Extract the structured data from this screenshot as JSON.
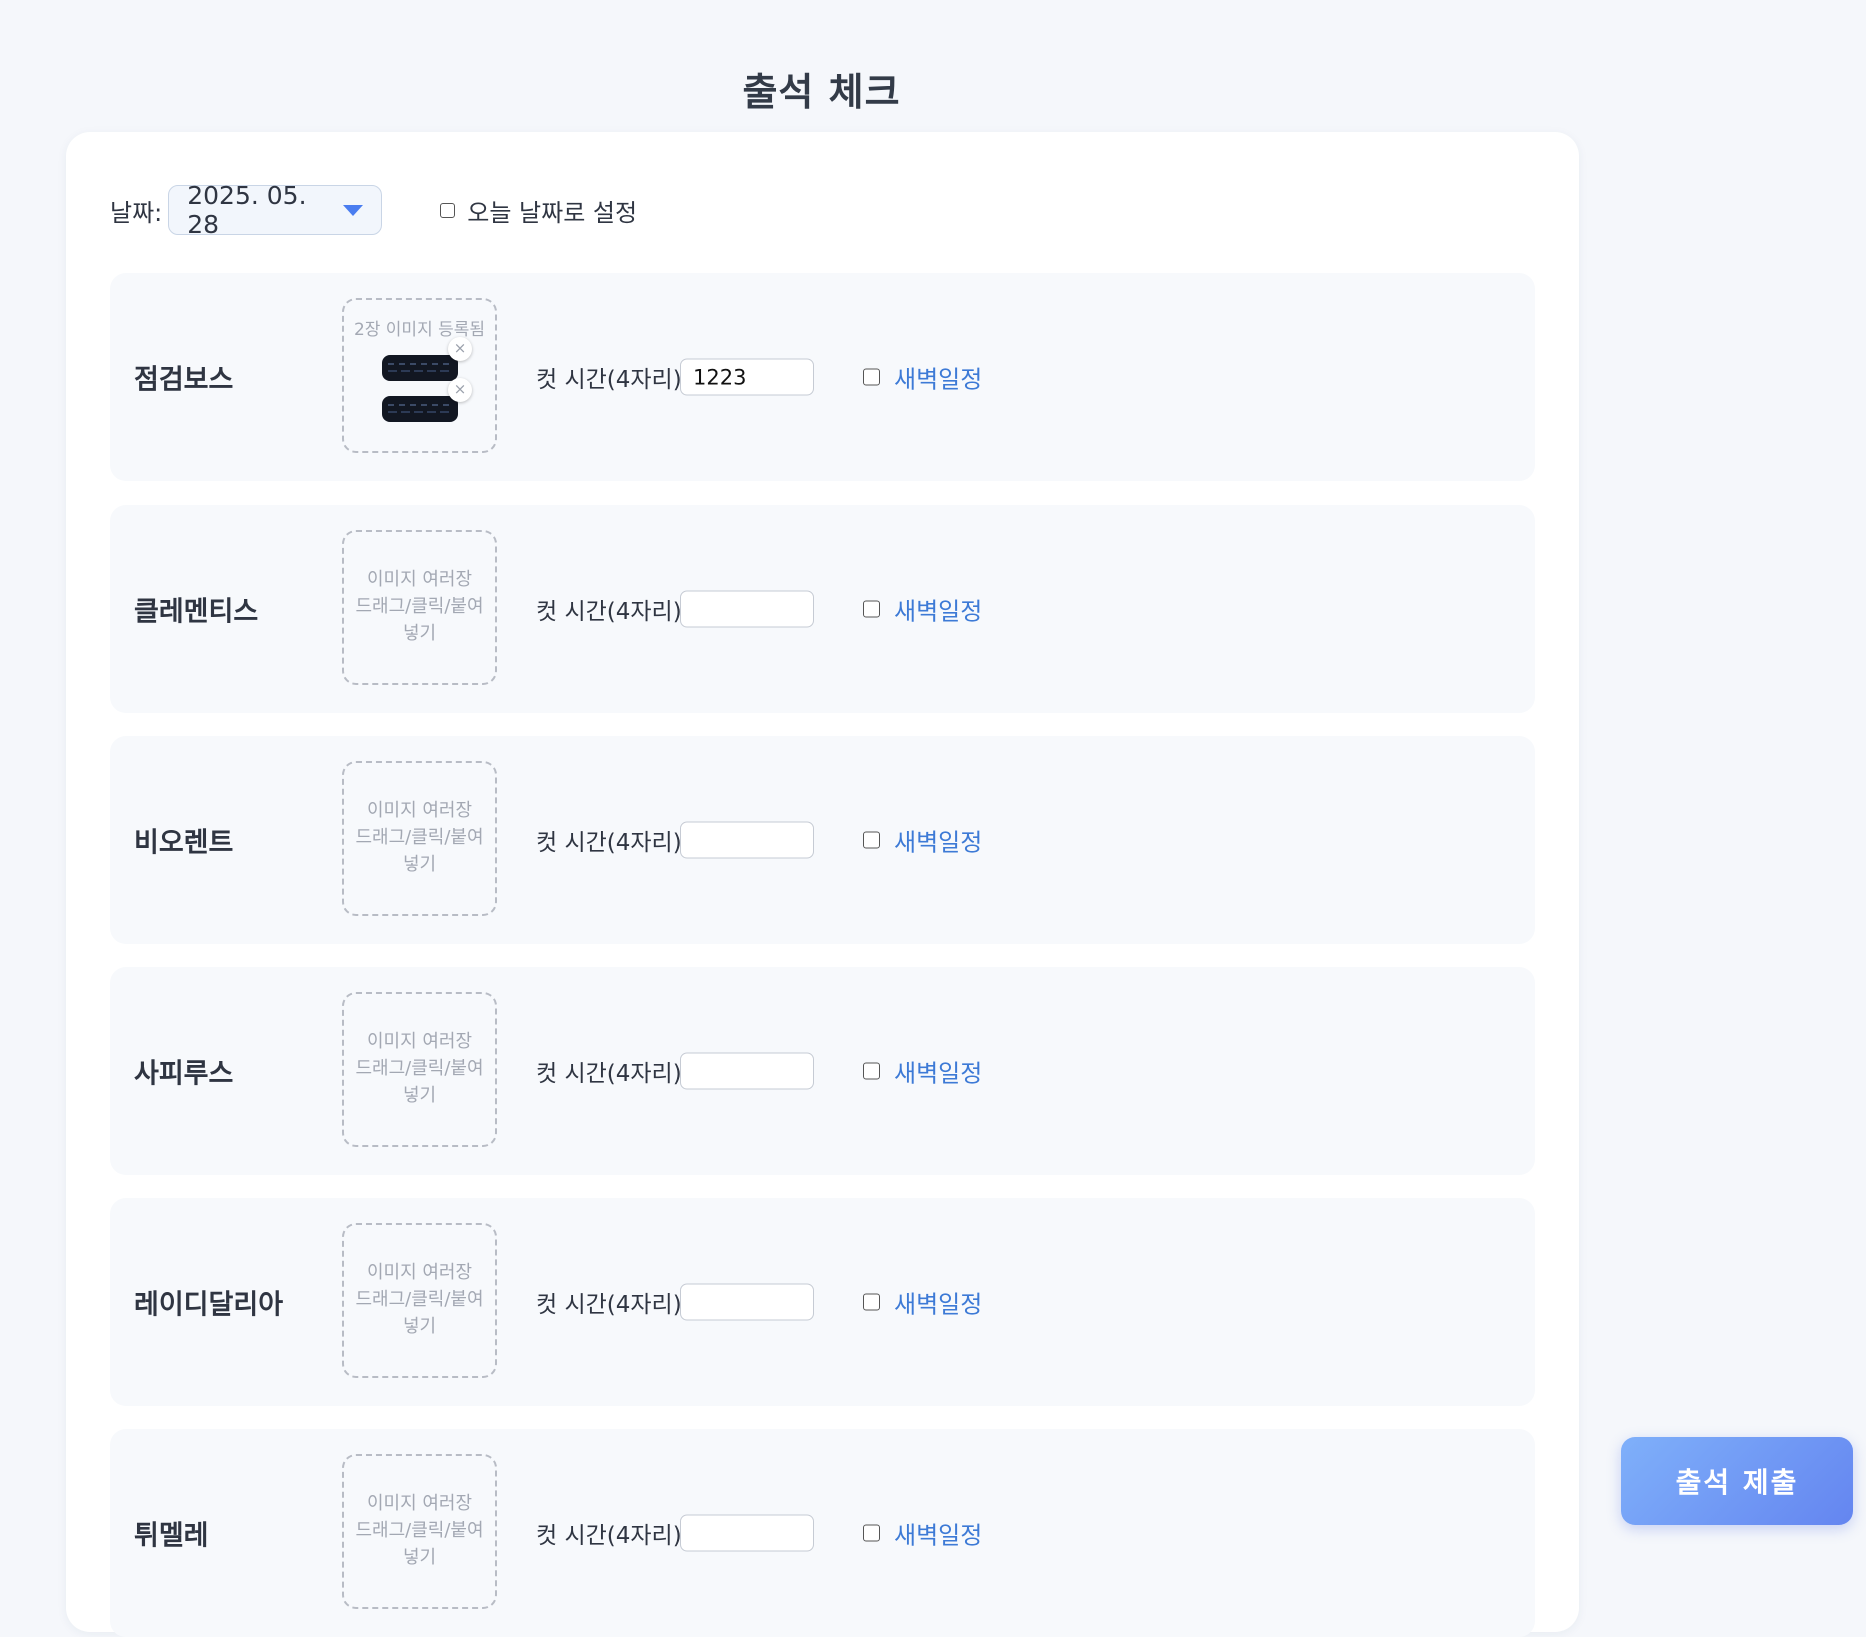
{
  "page": {
    "title": "출석 체크"
  },
  "date_row": {
    "label": "날짜:",
    "selected_date": "2025. 05. 28",
    "today_toggle_label": "오늘 날짜로 설정"
  },
  "bosses": [
    {
      "name": "점검보스",
      "dropzone_count_text": "2장 이미지 등록됨",
      "images": [
        "image-1",
        "image-2"
      ],
      "cut_label": "컷 시간(4자리)",
      "cut_value": "1223",
      "dawn_label": "새벽일정"
    },
    {
      "name": "클레멘티스",
      "dropzone_hint": "이미지 여러장\n드래그/클릭/붙여\n넣기",
      "cut_label": "컷 시간(4자리)",
      "cut_value": "",
      "dawn_label": "새벽일정"
    },
    {
      "name": "비오렌트",
      "dropzone_hint": "이미지 여러장\n드래그/클릭/붙여\n넣기",
      "cut_label": "컷 시간(4자리)",
      "cut_value": "",
      "dawn_label": "새벽일정"
    },
    {
      "name": "사피루스",
      "dropzone_hint": "이미지 여러장\n드래그/클릭/붙여\n넣기",
      "cut_label": "컷 시간(4자리)",
      "cut_value": "",
      "dawn_label": "새벽일정"
    },
    {
      "name": "레이디달리아",
      "dropzone_hint": "이미지 여러장\n드래그/클릭/붙여\n넣기",
      "cut_label": "컷 시간(4자리)",
      "cut_value": "",
      "dawn_label": "새벽일정"
    },
    {
      "name": "튀멜레",
      "dropzone_hint": "이미지 여러장\n드래그/클릭/붙여\n넣기",
      "cut_label": "컷 시간(4자리)",
      "cut_value": "",
      "dawn_label": "새벽일정"
    }
  ],
  "submit": {
    "label": "출석 제출"
  },
  "colors": {
    "accent": "#4a7df0",
    "link": "#3d7ad6",
    "background": "#f5f7fb"
  },
  "icons": {
    "date_caret": "caret-down-icon",
    "remove_image": "close-icon"
  }
}
